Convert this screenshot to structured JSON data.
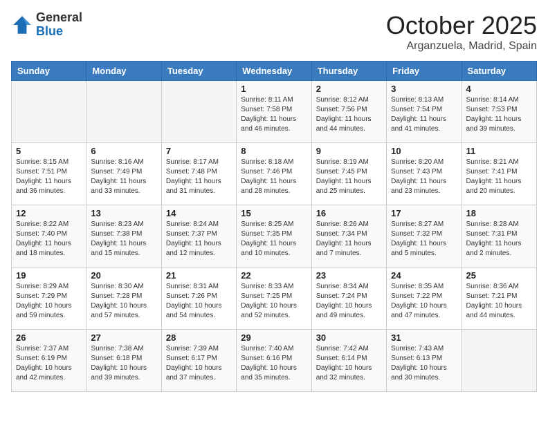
{
  "header": {
    "logo": {
      "general": "General",
      "blue": "Blue"
    },
    "title": "October 2025",
    "location": "Arganzuela, Madrid, Spain"
  },
  "calendar": {
    "days_of_week": [
      "Sunday",
      "Monday",
      "Tuesday",
      "Wednesday",
      "Thursday",
      "Friday",
      "Saturday"
    ],
    "weeks": [
      [
        {
          "day": "",
          "info": ""
        },
        {
          "day": "",
          "info": ""
        },
        {
          "day": "",
          "info": ""
        },
        {
          "day": "1",
          "info": "Sunrise: 8:11 AM\nSunset: 7:58 PM\nDaylight: 11 hours and 46 minutes."
        },
        {
          "day": "2",
          "info": "Sunrise: 8:12 AM\nSunset: 7:56 PM\nDaylight: 11 hours and 44 minutes."
        },
        {
          "day": "3",
          "info": "Sunrise: 8:13 AM\nSunset: 7:54 PM\nDaylight: 11 hours and 41 minutes."
        },
        {
          "day": "4",
          "info": "Sunrise: 8:14 AM\nSunset: 7:53 PM\nDaylight: 11 hours and 39 minutes."
        }
      ],
      [
        {
          "day": "5",
          "info": "Sunrise: 8:15 AM\nSunset: 7:51 PM\nDaylight: 11 hours and 36 minutes."
        },
        {
          "day": "6",
          "info": "Sunrise: 8:16 AM\nSunset: 7:49 PM\nDaylight: 11 hours and 33 minutes."
        },
        {
          "day": "7",
          "info": "Sunrise: 8:17 AM\nSunset: 7:48 PM\nDaylight: 11 hours and 31 minutes."
        },
        {
          "day": "8",
          "info": "Sunrise: 8:18 AM\nSunset: 7:46 PM\nDaylight: 11 hours and 28 minutes."
        },
        {
          "day": "9",
          "info": "Sunrise: 8:19 AM\nSunset: 7:45 PM\nDaylight: 11 hours and 25 minutes."
        },
        {
          "day": "10",
          "info": "Sunrise: 8:20 AM\nSunset: 7:43 PM\nDaylight: 11 hours and 23 minutes."
        },
        {
          "day": "11",
          "info": "Sunrise: 8:21 AM\nSunset: 7:41 PM\nDaylight: 11 hours and 20 minutes."
        }
      ],
      [
        {
          "day": "12",
          "info": "Sunrise: 8:22 AM\nSunset: 7:40 PM\nDaylight: 11 hours and 18 minutes."
        },
        {
          "day": "13",
          "info": "Sunrise: 8:23 AM\nSunset: 7:38 PM\nDaylight: 11 hours and 15 minutes."
        },
        {
          "day": "14",
          "info": "Sunrise: 8:24 AM\nSunset: 7:37 PM\nDaylight: 11 hours and 12 minutes."
        },
        {
          "day": "15",
          "info": "Sunrise: 8:25 AM\nSunset: 7:35 PM\nDaylight: 11 hours and 10 minutes."
        },
        {
          "day": "16",
          "info": "Sunrise: 8:26 AM\nSunset: 7:34 PM\nDaylight: 11 hours and 7 minutes."
        },
        {
          "day": "17",
          "info": "Sunrise: 8:27 AM\nSunset: 7:32 PM\nDaylight: 11 hours and 5 minutes."
        },
        {
          "day": "18",
          "info": "Sunrise: 8:28 AM\nSunset: 7:31 PM\nDaylight: 11 hours and 2 minutes."
        }
      ],
      [
        {
          "day": "19",
          "info": "Sunrise: 8:29 AM\nSunset: 7:29 PM\nDaylight: 10 hours and 59 minutes."
        },
        {
          "day": "20",
          "info": "Sunrise: 8:30 AM\nSunset: 7:28 PM\nDaylight: 10 hours and 57 minutes."
        },
        {
          "day": "21",
          "info": "Sunrise: 8:31 AM\nSunset: 7:26 PM\nDaylight: 10 hours and 54 minutes."
        },
        {
          "day": "22",
          "info": "Sunrise: 8:33 AM\nSunset: 7:25 PM\nDaylight: 10 hours and 52 minutes."
        },
        {
          "day": "23",
          "info": "Sunrise: 8:34 AM\nSunset: 7:24 PM\nDaylight: 10 hours and 49 minutes."
        },
        {
          "day": "24",
          "info": "Sunrise: 8:35 AM\nSunset: 7:22 PM\nDaylight: 10 hours and 47 minutes."
        },
        {
          "day": "25",
          "info": "Sunrise: 8:36 AM\nSunset: 7:21 PM\nDaylight: 10 hours and 44 minutes."
        }
      ],
      [
        {
          "day": "26",
          "info": "Sunrise: 7:37 AM\nSunset: 6:19 PM\nDaylight: 10 hours and 42 minutes."
        },
        {
          "day": "27",
          "info": "Sunrise: 7:38 AM\nSunset: 6:18 PM\nDaylight: 10 hours and 39 minutes."
        },
        {
          "day": "28",
          "info": "Sunrise: 7:39 AM\nSunset: 6:17 PM\nDaylight: 10 hours and 37 minutes."
        },
        {
          "day": "29",
          "info": "Sunrise: 7:40 AM\nSunset: 6:16 PM\nDaylight: 10 hours and 35 minutes."
        },
        {
          "day": "30",
          "info": "Sunrise: 7:42 AM\nSunset: 6:14 PM\nDaylight: 10 hours and 32 minutes."
        },
        {
          "day": "31",
          "info": "Sunrise: 7:43 AM\nSunset: 6:13 PM\nDaylight: 10 hours and 30 minutes."
        },
        {
          "day": "",
          "info": ""
        }
      ]
    ]
  }
}
